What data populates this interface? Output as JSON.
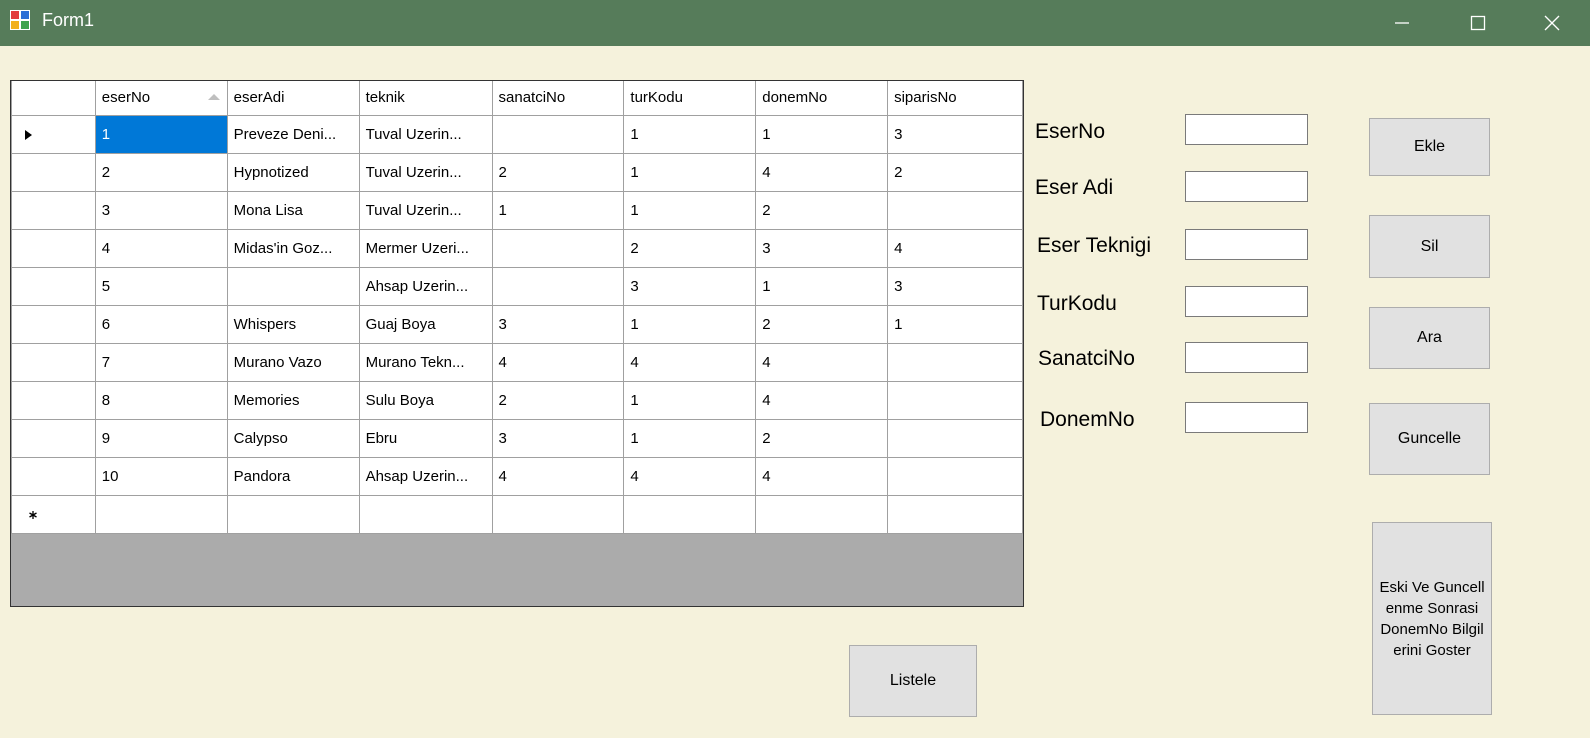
{
  "window": {
    "title": "Form1",
    "minimize_icon": "minimize-icon",
    "maximize_icon": "maximize-icon",
    "close_icon": "close-icon"
  },
  "grid": {
    "columns": [
      "eserNo",
      "eserAdi",
      "teknik",
      "sanatciNo",
      "turKodu",
      "donemNo",
      "siparisNo"
    ],
    "sorted_column": "eserNo",
    "sort_direction": "ascending",
    "rows": [
      [
        "1",
        "Preveze Deni...",
        "Tuval Uzerin...",
        "",
        "1",
        "1",
        "3"
      ],
      [
        "2",
        "Hypnotized",
        "Tuval Uzerin...",
        "2",
        "1",
        "4",
        "2"
      ],
      [
        "3",
        "Mona Lisa",
        "Tuval Uzerin...",
        "1",
        "1",
        "2",
        ""
      ],
      [
        "4",
        "Midas'in Goz...",
        "Mermer Uzeri...",
        "",
        "2",
        "3",
        "4"
      ],
      [
        "5",
        "",
        "Ahsap Uzerin...",
        "",
        "3",
        "1",
        "3"
      ],
      [
        "6",
        "Whispers",
        "Guaj Boya",
        "3",
        "1",
        "2",
        "1"
      ],
      [
        "7",
        "Murano Vazo",
        "Murano Tekn...",
        "4",
        "4",
        "4",
        ""
      ],
      [
        "8",
        "Memories",
        "Sulu Boya",
        "2",
        "1",
        "4",
        ""
      ],
      [
        "9",
        "Calypso",
        "Ebru",
        "3",
        "1",
        "2",
        ""
      ],
      [
        "10",
        "Pandora",
        "Ahsap Uzerin...",
        "4",
        "4",
        "4",
        ""
      ]
    ],
    "current_row_index": 0,
    "selected_cell": {
      "row": 0,
      "column": "eserNo"
    },
    "selection_color": "#0078d7"
  },
  "form": {
    "labels": {
      "eserno": "EserNo",
      "eser_adi": "Eser Adi",
      "eser_teknigi": "Eser Teknigi",
      "turkodu": "TurKodu",
      "sanatcino": "SanatciNo",
      "donemno": "DonemNo"
    },
    "values": {
      "eserno": "",
      "eser_adi": "",
      "eser_teknigi": "",
      "turkodu": "",
      "sanatcino": "",
      "donemno": ""
    }
  },
  "buttons": {
    "ekle": "Ekle",
    "sil": "Sil",
    "ara": "Ara",
    "guncelle": "Guncelle",
    "listele": "Listele",
    "eski_ve_guncellenme": "Eski Ve Guncellenme Sonrasi DonemNo Bilgilerini Goster"
  },
  "colors": {
    "titlebar": "#567c5a",
    "form_background": "#f5f2dc",
    "grid_background": "#ababab",
    "button_face": "#e1e1e1"
  }
}
